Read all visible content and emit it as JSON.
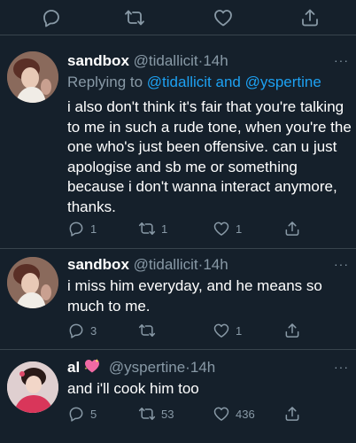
{
  "colors": {
    "background": "#15202b",
    "divider": "#38444d",
    "secondary_text": "#8899a6",
    "mention": "#1da1f2",
    "primary_text": "#ffffff"
  },
  "top_actions": [
    "reply-icon",
    "retweet-icon",
    "like-icon",
    "share-icon"
  ],
  "tweets": [
    {
      "name": "sandbox",
      "handle": "@tidallicit",
      "sep": "·",
      "time": "14h",
      "replying_prefix": "Replying to ",
      "replying_mentions": "@tidallicit and @yspertine",
      "text": "i also don't think it's fair that you're talking to me in such a rude tone, when you're the one who's just been offensive. can u just apologise and sb me or something because i don't wanna interact anymore, thanks.",
      "more": "···",
      "replies": "1",
      "retweets": "1",
      "likes": "1"
    },
    {
      "name": "sandbox",
      "handle": "@tidallicit",
      "sep": "·",
      "time": "14h",
      "text": "i miss him everyday, and he means so much to me.",
      "more": "···",
      "replies": "3",
      "retweets": "",
      "likes": "1"
    },
    {
      "name": "al",
      "handle": "@yspertine",
      "sep": "·",
      "time": "14h",
      "name_emoji": "sparkling-heart-emoji",
      "text": "and i'll cook him too",
      "more": "···",
      "replies": "5",
      "retweets": "53",
      "likes": "436"
    }
  ]
}
